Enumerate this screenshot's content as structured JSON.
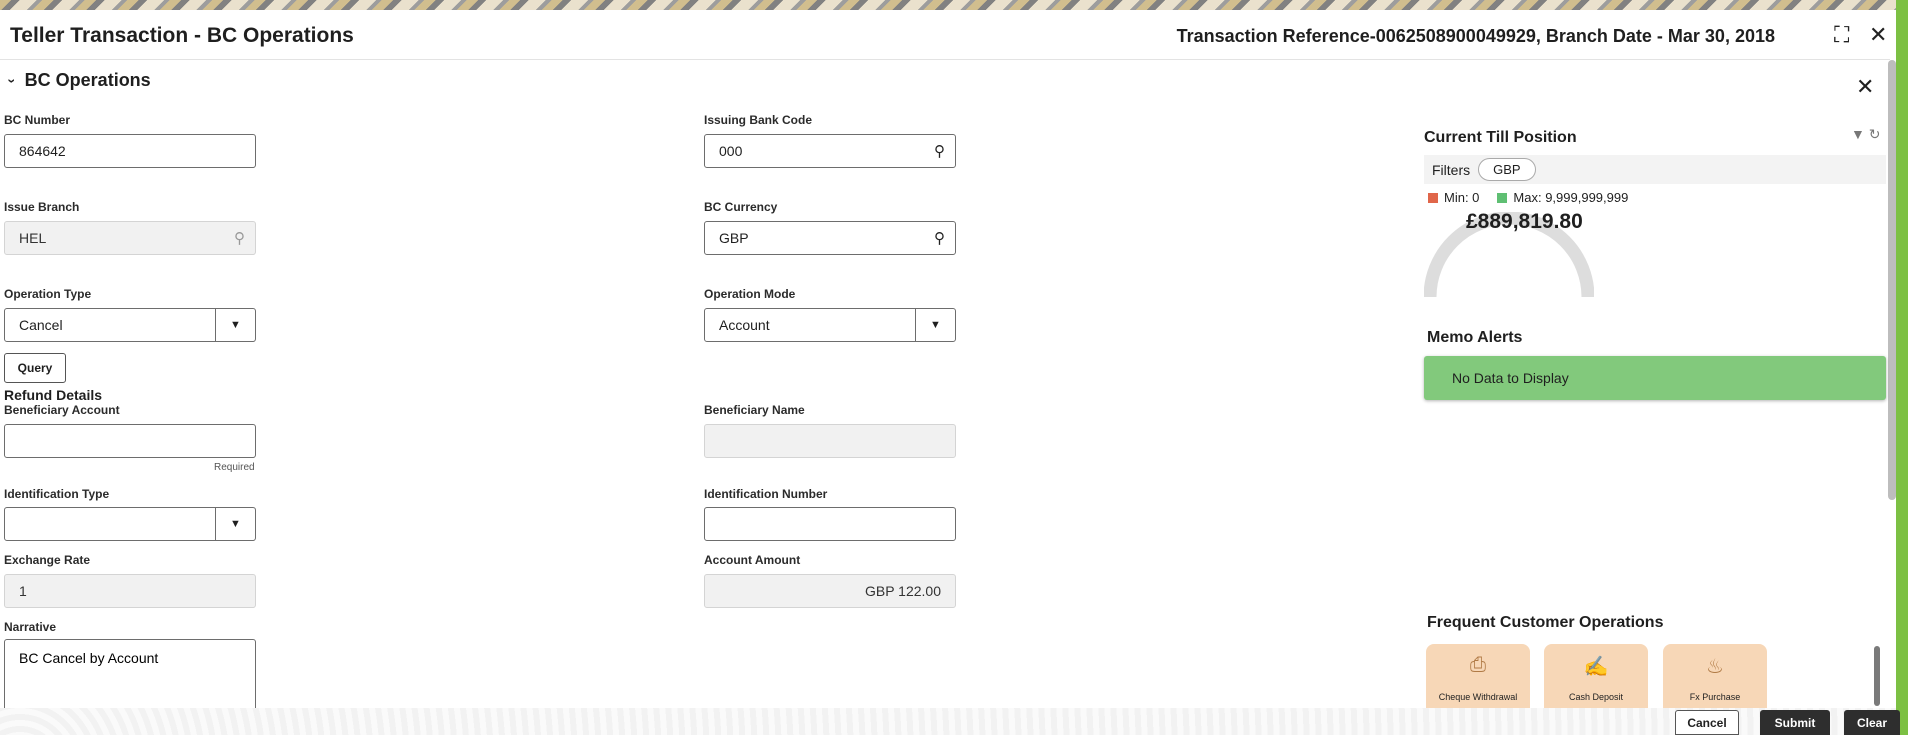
{
  "header": {
    "title": "Teller Transaction - BC Operations",
    "transaction_reference": "Transaction Reference-0062508900049929, Branch Date - Mar 30, 2018"
  },
  "section": {
    "title": "BC Operations"
  },
  "form": {
    "bc_number": {
      "label": "BC Number",
      "value": "864642"
    },
    "issuing_bank_code": {
      "label": "Issuing Bank Code",
      "value": "000"
    },
    "issue_branch": {
      "label": "Issue Branch",
      "value": "HEL"
    },
    "bc_currency": {
      "label": "BC Currency",
      "value": "GBP"
    },
    "operation_type": {
      "label": "Operation Type",
      "value": "Cancel"
    },
    "operation_mode": {
      "label": "Operation Mode",
      "value": "Account"
    },
    "query_button": "Query",
    "refund_details": "Refund Details",
    "beneficiary_account": {
      "label": "Beneficiary Account",
      "value": "",
      "hint": "Required"
    },
    "beneficiary_name": {
      "label": "Beneficiary Name",
      "value": ""
    },
    "identification_type": {
      "label": "Identification Type",
      "value": ""
    },
    "identification_number": {
      "label": "Identification Number",
      "value": ""
    },
    "exchange_rate": {
      "label": "Exchange Rate",
      "value": "1"
    },
    "account_amount": {
      "label": "Account Amount",
      "value": "GBP 122.00"
    },
    "narrative": {
      "label": "Narrative",
      "value": "BC Cancel by Account"
    }
  },
  "till": {
    "title": "Current Till Position",
    "filters_label": "Filters",
    "currency_chip": "GBP",
    "min_label": "Min: 0",
    "max_label": "Max: 9,999,999,999",
    "amount": "£889,819.80",
    "min_color": "#e0664a",
    "max_color": "#5fbf73"
  },
  "memo": {
    "title": "Memo Alerts",
    "message": "No Data to Display"
  },
  "frequent_ops": {
    "title": "Frequent Customer Operations",
    "items": [
      {
        "label": "Cheque Withdrawal",
        "icon": "cheque-icon"
      },
      {
        "label": "Cash Deposit",
        "icon": "cash-deposit-icon"
      },
      {
        "label": "Fx Purchase",
        "icon": "fx-purchase-icon"
      }
    ]
  },
  "footer": {
    "cancel": "Cancel",
    "submit": "Submit",
    "clear": "Clear"
  }
}
